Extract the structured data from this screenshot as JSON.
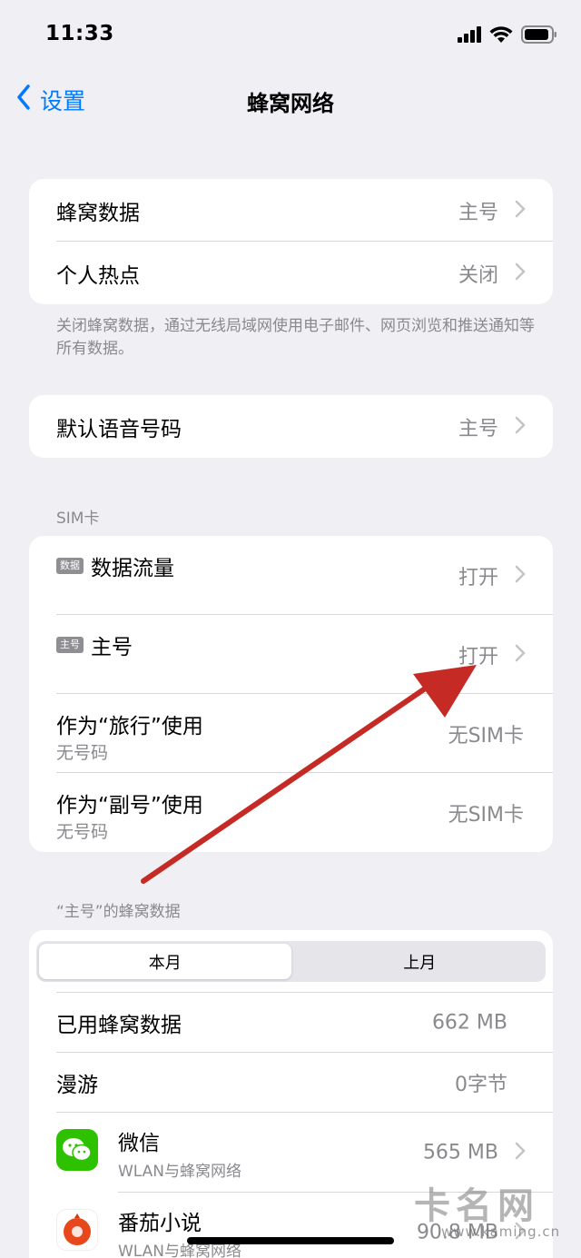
{
  "status_bar": {
    "time": "11:33"
  },
  "nav": {
    "back_label": "设置",
    "title": "蜂窝网络"
  },
  "group1": {
    "rows": [
      {
        "label": "蜂窝数据",
        "value": "主号"
      },
      {
        "label": "个人热点",
        "value": "关闭"
      }
    ],
    "footnote": "关闭蜂窝数据，通过无线局域网使用电子邮件、网页浏览和推送通知等所有数据。"
  },
  "group2": {
    "label": "默认语音号码",
    "value": "主号"
  },
  "sim_section": {
    "header": "SIM卡",
    "rows": [
      {
        "badge": "数据",
        "label": "数据流量",
        "value": "打开"
      },
      {
        "badge": "主号",
        "label": "主号",
        "value": "打开"
      },
      {
        "label": "作为“旅行”使用",
        "sub": "无号码",
        "value": "无SIM卡"
      },
      {
        "label": "作为“副号”使用",
        "sub": "无号码",
        "value": "无SIM卡"
      }
    ]
  },
  "usage_section": {
    "header": "“主号”的蜂窝数据",
    "segments": [
      "本月",
      "上月"
    ],
    "active_segment": "本月",
    "rows": [
      {
        "label": "已用蜂窝数据",
        "value": "662 MB"
      },
      {
        "label": "漫游",
        "value": "0字节"
      }
    ],
    "apps": [
      {
        "name": "微信",
        "sub": "WLAN与蜂窝网络",
        "value": "565 MB",
        "icon": "wechat-icon",
        "color": "#2dc100"
      },
      {
        "name": "番茄小说",
        "sub": "WLAN与蜂窝网络",
        "value": "90.8 MB",
        "icon": "fanqie-novel-icon",
        "color": "#e8471b"
      }
    ]
  },
  "watermark": {
    "text": "卡名网",
    "url": "www.kaming.cn"
  },
  "colors": {
    "accent": "#007aff",
    "annotation_arrow": "#c62a24"
  }
}
